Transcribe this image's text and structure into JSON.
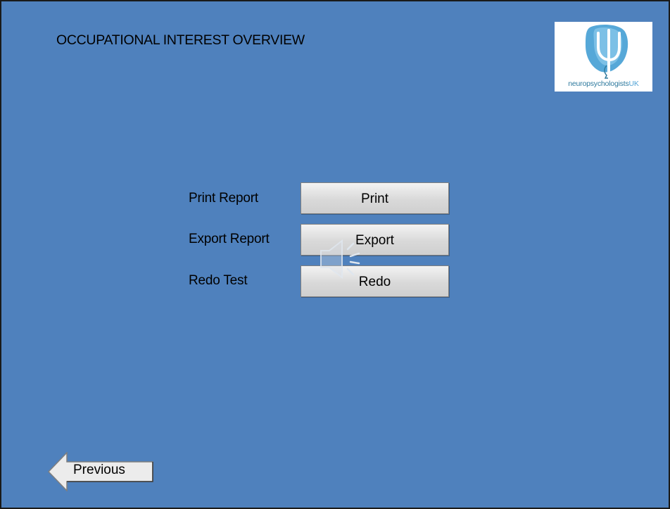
{
  "slide": {
    "title": "OCCUPATIONAL INTEREST OVERVIEW",
    "background_color": "#4f81bd"
  },
  "logo": {
    "text": "neuropsychologists",
    "text_suffix": "UK",
    "icon": "psi-symbol-icon"
  },
  "actions": [
    {
      "label": "Print Report",
      "button": "Print"
    },
    {
      "label": "Export Report",
      "button": "Export"
    },
    {
      "label": "Redo Test",
      "button": "Redo"
    }
  ],
  "audio": {
    "icon": "speaker-icon"
  },
  "navigation": {
    "previous_label": "Previous",
    "icon": "left-arrow-icon"
  }
}
